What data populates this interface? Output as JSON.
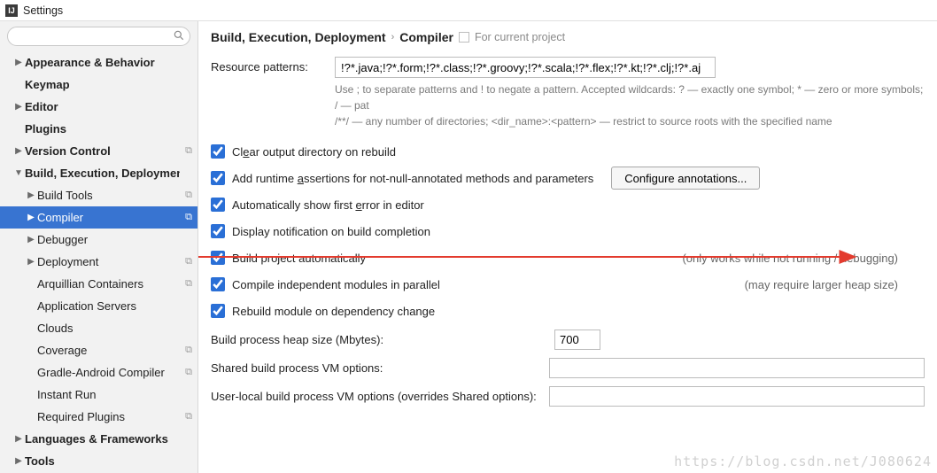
{
  "window": {
    "title": "Settings"
  },
  "search": {
    "placeholder": ""
  },
  "sidebar": [
    {
      "label": "Appearance & Behavior",
      "arrow": "right",
      "bold": true,
      "pad": 1,
      "scope": false
    },
    {
      "label": "Keymap",
      "arrow": "none",
      "bold": true,
      "pad": 1,
      "scope": false
    },
    {
      "label": "Editor",
      "arrow": "right",
      "bold": true,
      "pad": 1,
      "scope": false
    },
    {
      "label": "Plugins",
      "arrow": "none",
      "bold": true,
      "pad": 1,
      "scope": false
    },
    {
      "label": "Version Control",
      "arrow": "right",
      "bold": true,
      "pad": 1,
      "scope": true
    },
    {
      "label": "Build, Execution, Deployment",
      "arrow": "down",
      "bold": true,
      "pad": 1,
      "scope": false
    },
    {
      "label": "Build Tools",
      "arrow": "right",
      "bold": false,
      "pad": 2,
      "scope": true
    },
    {
      "label": "Compiler",
      "arrow": "right",
      "bold": false,
      "pad": 2,
      "scope": true,
      "selected": true
    },
    {
      "label": "Debugger",
      "arrow": "right",
      "bold": false,
      "pad": 2,
      "scope": false
    },
    {
      "label": "Deployment",
      "arrow": "right",
      "bold": false,
      "pad": 2,
      "scope": true
    },
    {
      "label": "Arquillian Containers",
      "arrow": "none",
      "bold": false,
      "pad": 2,
      "scope": true
    },
    {
      "label": "Application Servers",
      "arrow": "none",
      "bold": false,
      "pad": 2,
      "scope": false
    },
    {
      "label": "Clouds",
      "arrow": "none",
      "bold": false,
      "pad": 2,
      "scope": false
    },
    {
      "label": "Coverage",
      "arrow": "none",
      "bold": false,
      "pad": 2,
      "scope": true
    },
    {
      "label": "Gradle-Android Compiler",
      "arrow": "none",
      "bold": false,
      "pad": 2,
      "scope": true
    },
    {
      "label": "Instant Run",
      "arrow": "none",
      "bold": false,
      "pad": 2,
      "scope": false
    },
    {
      "label": "Required Plugins",
      "arrow": "none",
      "bold": false,
      "pad": 2,
      "scope": true
    },
    {
      "label": "Languages & Frameworks",
      "arrow": "right",
      "bold": true,
      "pad": 1,
      "scope": false
    },
    {
      "label": "Tools",
      "arrow": "right",
      "bold": true,
      "pad": 1,
      "scope": false
    }
  ],
  "breadcrumb": {
    "a": "Build, Execution, Deployment",
    "b": "Compiler",
    "scope": "For current project"
  },
  "form": {
    "resource_patterns_label": "Resource patterns:",
    "resource_patterns_value": "!?*.java;!?*.form;!?*.class;!?*.groovy;!?*.scala;!?*.flex;!?*.kt;!?*.clj;!?*.aj",
    "hint_a": "Use ; to separate patterns and ! to negate a pattern. Accepted wildcards: ? — exactly one symbol; * — zero or more symbols; / — pat",
    "hint_b": "/**/ — any number of directories; <dir_name>:<pattern> — restrict to source roots with the specified name",
    "checks": {
      "clear_output": {
        "pre": "Cl",
        "u": "e",
        "post": "ar output directory on rebuild",
        "checked": true
      },
      "add_runtime": {
        "pre": "Add runtime ",
        "u": "a",
        "post": "ssertions for not-null-annotated methods and parameters",
        "checked": true,
        "button": "Configure annotations..."
      },
      "auto_show_error": {
        "pre": "Automatically show first ",
        "u": "e",
        "post": "rror in editor",
        "checked": true
      },
      "display_notif": {
        "pre": "Display notification on build completion",
        "u": "",
        "post": "",
        "checked": true
      },
      "build_auto": {
        "pre": "Build project automatically",
        "u": "",
        "post": "",
        "checked": true,
        "note": "(only works while not running / debugging)"
      },
      "compile_parallel": {
        "pre": "Compile independent modules in parallel",
        "u": "",
        "post": "",
        "checked": true,
        "note": "(may require larger heap size)"
      },
      "rebuild_dep": {
        "pre": "Rebuild module on dependency change",
        "u": "",
        "post": "",
        "checked": true
      }
    },
    "heap_label": "Build process heap size (Mbytes):",
    "heap_value": "700",
    "shared_vm_label": "Shared build process VM options:",
    "shared_vm_value": "",
    "user_vm_label": "User-local build process VM options (overrides Shared options):",
    "user_vm_value": ""
  },
  "watermark": "https://blog.csdn.net/J080624"
}
